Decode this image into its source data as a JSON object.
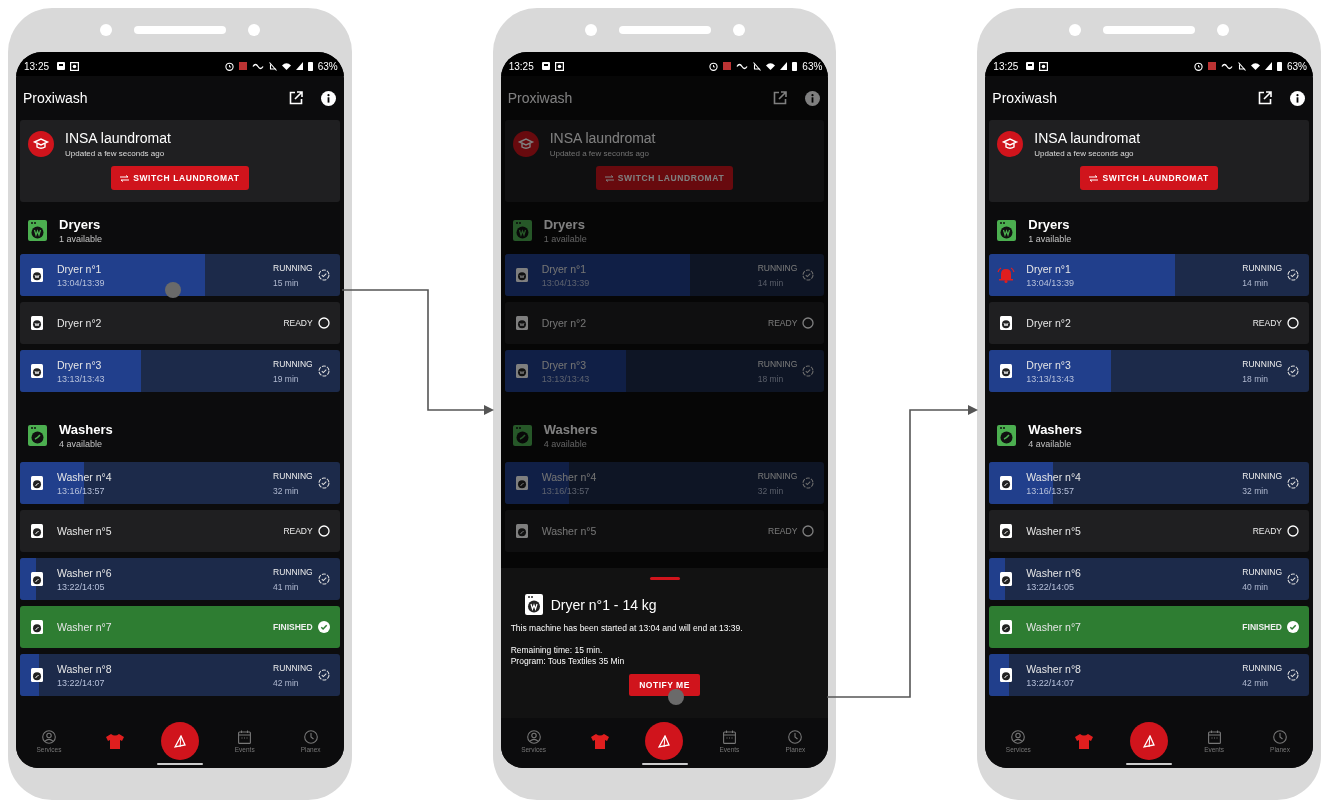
{
  "phones": [
    {
      "dimmed": false,
      "status_bar": {
        "time": "13:25",
        "battery": "63%"
      },
      "app_title": "Proxiwash",
      "laundromat": {
        "name": "INSA laundromat",
        "updated": "Updated a few seconds ago",
        "button": "SWITCH LAUNDROMAT"
      },
      "sections": [
        {
          "kind": "dryer",
          "title": "Dryers",
          "subtitle": "1 available",
          "machines": [
            {
              "name": "Dryer n°1",
              "times": "13:04/13:39",
              "kind": "running",
              "status": "RUNNING",
              "remaining": "15 min",
              "level": 0.58,
              "notify": false
            },
            {
              "name": "Dryer n°2",
              "kind": "ready",
              "status": "READY",
              "notify": false
            },
            {
              "name": "Dryer n°3",
              "times": "13:13/13:43",
              "kind": "running",
              "status": "RUNNING",
              "remaining": "19 min",
              "level": 0.38,
              "notify": false
            }
          ]
        },
        {
          "kind": "washer",
          "title": "Washers",
          "subtitle": "4 available",
          "machines": [
            {
              "name": "Washer n°4",
              "times": "13:16/13:57",
              "kind": "running",
              "status": "RUNNING",
              "remaining": "32 min",
              "level": 0.2,
              "notify": false
            },
            {
              "name": "Washer n°5",
              "kind": "ready",
              "status": "READY",
              "notify": false
            },
            {
              "name": "Washer n°6",
              "times": "13:22/14:05",
              "kind": "running",
              "status": "RUNNING",
              "remaining": "41 min",
              "level": 0.05,
              "notify": false
            },
            {
              "name": "Washer n°7",
              "kind": "finished",
              "status": "FINISHED",
              "notify": false
            },
            {
              "name": "Washer n°8",
              "times": "13:22/14:07",
              "kind": "running",
              "status": "RUNNING",
              "remaining": "42 min",
              "level": 0.06,
              "notify": false
            }
          ]
        }
      ],
      "nav": [
        {
          "kind": "tab",
          "label": "Services",
          "selected": false
        },
        {
          "kind": "tab",
          "selected": true
        },
        {
          "kind": "fab"
        },
        {
          "kind": "tab",
          "label": "Events",
          "selected": false
        },
        {
          "kind": "tab",
          "label": "Planex",
          "selected": false
        }
      ]
    },
    {
      "dimmed": true,
      "status_bar": {
        "time": "13:25",
        "battery": "63%"
      },
      "app_title": "Proxiwash",
      "laundromat": {
        "name": "INSA laundromat",
        "updated": "Updated a few seconds ago",
        "button": "SWITCH LAUNDROMAT"
      },
      "sections": [
        {
          "kind": "dryer",
          "title": "Dryers",
          "subtitle": "1 available",
          "machines": [
            {
              "name": "Dryer n°1",
              "times": "13:04/13:39",
              "kind": "running",
              "status": "RUNNING",
              "remaining": "14 min",
              "level": 0.58,
              "notify": false
            },
            {
              "name": "Dryer n°2",
              "kind": "ready",
              "status": "READY",
              "notify": false
            },
            {
              "name": "Dryer n°3",
              "times": "13:13/13:43",
              "kind": "running",
              "status": "RUNNING",
              "remaining": "18 min",
              "level": 0.38,
              "notify": false
            }
          ]
        },
        {
          "kind": "washer",
          "title": "Washers",
          "subtitle": "4 available",
          "machines": [
            {
              "name": "Washer n°4",
              "times": "13:16/13:57",
              "kind": "running",
              "status": "RUNNING",
              "remaining": "32 min",
              "level": 0.2,
              "notify": false
            },
            {
              "name": "Washer n°5",
              "kind": "ready",
              "status": "READY",
              "notify": false
            }
          ]
        }
      ],
      "sheet": {
        "kind": "dryer",
        "title": "Dryer n°1 - 14 kg",
        "description": "This machine has been started at 13:04 and will end at 13:39.",
        "remaining": "Remaining time: 15 min.",
        "program": "Program: Tous Textiles 35 Min",
        "button": "NOTIFY ME"
      },
      "nav": [
        {
          "kind": "tab",
          "label": "Services",
          "selected": false
        },
        {
          "kind": "tab",
          "selected": true
        },
        {
          "kind": "fab"
        },
        {
          "kind": "tab",
          "label": "Events",
          "selected": false
        },
        {
          "kind": "tab",
          "label": "Planex",
          "selected": false
        }
      ]
    },
    {
      "dimmed": false,
      "status_bar": {
        "time": "13:25",
        "battery": "63%"
      },
      "app_title": "Proxiwash",
      "laundromat": {
        "name": "INSA laundromat",
        "updated": "Updated a few seconds ago",
        "button": "SWITCH LAUNDROMAT"
      },
      "sections": [
        {
          "kind": "dryer",
          "title": "Dryers",
          "subtitle": "1 available",
          "machines": [
            {
              "name": "Dryer n°1",
              "times": "13:04/13:39",
              "kind": "running",
              "status": "RUNNING",
              "remaining": "14 min",
              "level": 0.58,
              "notify": true
            },
            {
              "name": "Dryer n°2",
              "kind": "ready",
              "status": "READY",
              "notify": false
            },
            {
              "name": "Dryer n°3",
              "times": "13:13/13:43",
              "kind": "running",
              "status": "RUNNING",
              "remaining": "18 min",
              "level": 0.38,
              "notify": false
            }
          ]
        },
        {
          "kind": "washer",
          "title": "Washers",
          "subtitle": "4 available",
          "machines": [
            {
              "name": "Washer n°4",
              "times": "13:16/13:57",
              "kind": "running",
              "status": "RUNNING",
              "remaining": "32 min",
              "level": 0.2,
              "notify": false
            },
            {
              "name": "Washer n°5",
              "kind": "ready",
              "status": "READY",
              "notify": false
            },
            {
              "name": "Washer n°6",
              "times": "13:22/14:05",
              "kind": "running",
              "status": "RUNNING",
              "remaining": "40 min",
              "level": 0.05,
              "notify": false
            },
            {
              "name": "Washer n°7",
              "kind": "finished",
              "status": "FINISHED",
              "notify": false
            },
            {
              "name": "Washer n°8",
              "times": "13:22/14:07",
              "kind": "running",
              "status": "RUNNING",
              "remaining": "42 min",
              "level": 0.06,
              "notify": false
            }
          ]
        }
      ],
      "nav": [
        {
          "kind": "tab",
          "label": "Services",
          "selected": false
        },
        {
          "kind": "tab",
          "selected": true
        },
        {
          "kind": "fab"
        },
        {
          "kind": "tab",
          "label": "Events",
          "selected": false
        },
        {
          "kind": "tab",
          "label": "Planex",
          "selected": false
        }
      ]
    }
  ]
}
